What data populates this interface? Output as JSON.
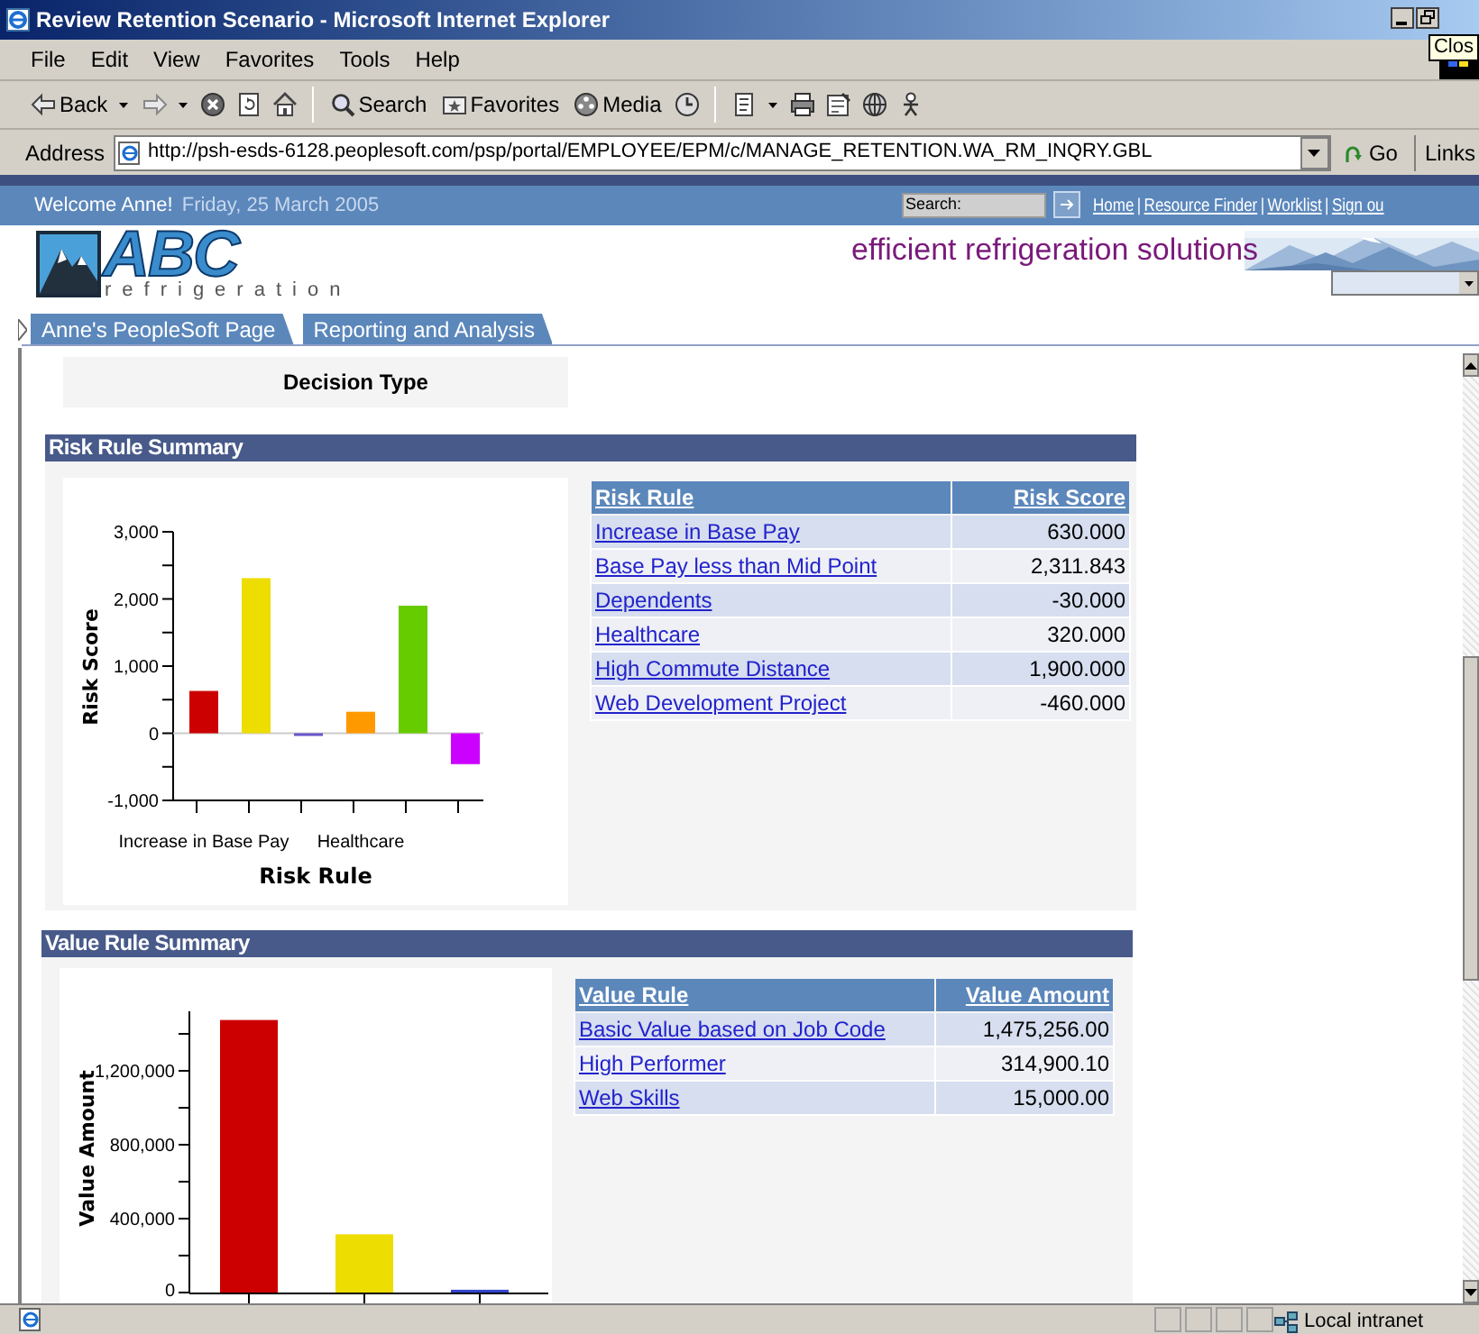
{
  "window": {
    "title": "Review Retention Scenario - Microsoft Internet Explorer",
    "tooltip": "Clos"
  },
  "menu": [
    "File",
    "Edit",
    "View",
    "Favorites",
    "Tools",
    "Help"
  ],
  "toolbar": [
    {
      "kind": "back",
      "label": "Back"
    },
    {
      "kind": "forward"
    },
    {
      "kind": "stop"
    },
    {
      "kind": "refresh"
    },
    {
      "kind": "home"
    },
    {
      "kind": "search",
      "label": "Search"
    },
    {
      "kind": "favorites",
      "label": "Favorites"
    },
    {
      "kind": "media",
      "label": "Media"
    },
    {
      "kind": "history"
    },
    {
      "kind": "mail"
    },
    {
      "kind": "print"
    },
    {
      "kind": "edit"
    },
    {
      "kind": "messenger"
    },
    {
      "kind": "person"
    }
  ],
  "address": {
    "label": "Address",
    "value": "http://psh-esds-6128.peoplesoft.com/psp/portal/EMPLOYEE/EPM/c/MANAGE_RETENTION.WA_RM_INQRY.GBL",
    "go": "Go",
    "links": "Links"
  },
  "portal": {
    "welcome": "Welcome Anne!",
    "date": "Friday, 25 March 2005",
    "search_label": "Search:",
    "separator": "|",
    "links": [
      "Home",
      "Resource Finder",
      "Worklist",
      "Sign ou"
    ]
  },
  "branding": {
    "logo": "ABC",
    "logo_sub": "refrigeration",
    "tagline": "efficient refrigeration solutions"
  },
  "tabs": [
    "Anne's PeopleSoft Page",
    "Reporting and Analysis"
  ],
  "decision_type": {
    "label": "Decision Type"
  },
  "sections": [
    {
      "title": "Risk Rule Summary",
      "columns": [
        "Risk Rule",
        "Risk Score"
      ],
      "rows": [
        {
          "rule": "Increase in Base Pay",
          "value": "630.000"
        },
        {
          "rule": "Base Pay less than Mid Point",
          "value": "2,311.843"
        },
        {
          "rule": "Dependents",
          "value": "-30.000"
        },
        {
          "rule": "Healthcare",
          "value": "320.000"
        },
        {
          "rule": "High Commute Distance",
          "value": "1,900.000"
        },
        {
          "rule": "Web Development Project",
          "value": "-460.000"
        }
      ],
      "chart_data": {
        "type": "bar",
        "xlabel": "Risk Rule",
        "ylabel": "Risk Score",
        "ylim": [
          -1000,
          3000
        ],
        "categories": [
          "Increase in Base Pay",
          null,
          null,
          "Healthcare",
          null,
          null
        ],
        "yticks": [
          {
            "value": -1000,
            "label": "-1,000"
          },
          {
            "value": 0,
            "label": "0"
          },
          {
            "value": 1000,
            "label": "1,000"
          },
          {
            "value": 2000,
            "label": "2,000"
          },
          {
            "value": 3000,
            "label": "3,000"
          }
        ],
        "series": [
          {
            "colors": [
              "#cc0000",
              "#eedd00",
              "#6655cc",
              "#ff9900",
              "#66cc00",
              "#cc00ff"
            ],
            "values": [
              630,
              2310,
              -30,
              320,
              1900,
              -460
            ]
          }
        ]
      }
    },
    {
      "title": "Value Rule Summary",
      "columns": [
        "Value Rule",
        "Value Amount"
      ],
      "rows": [
        {
          "rule": "Basic Value based on Job Code",
          "value": "1,475,256.00"
        },
        {
          "rule": "High Performer",
          "value": "314,900.10"
        },
        {
          "rule": "Web Skills",
          "value": "15,000.00"
        }
      ],
      "chart_data": {
        "type": "bar",
        "ylabel": "Value Amount",
        "ylim": [
          0,
          1500000
        ],
        "yticks": [
          {
            "value": 0,
            "label": "0"
          },
          {
            "value": 400000,
            "label": "400,000"
          },
          {
            "value": 800000,
            "label": "800,000"
          },
          {
            "value": 1200000,
            "label": "1,200,000"
          }
        ],
        "series": [
          {
            "colors": [
              "#cc0000",
              "#eedd00",
              "#3344cc"
            ],
            "values": [
              1475000,
              315000,
              15000
            ]
          }
        ]
      }
    }
  ],
  "status_bar": {
    "zone": "Local intranet"
  }
}
